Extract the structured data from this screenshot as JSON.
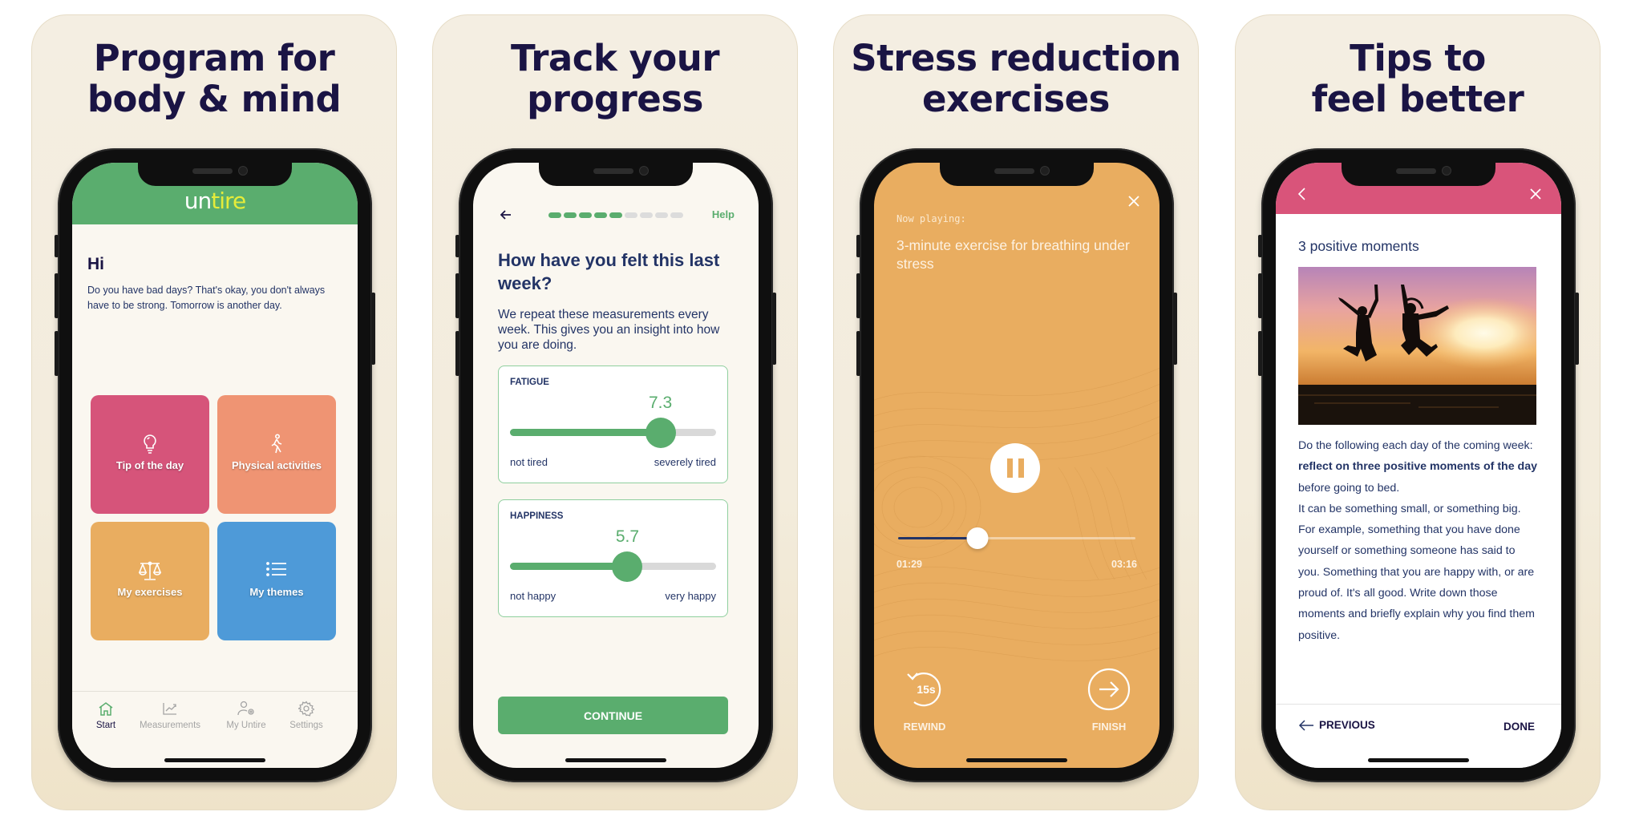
{
  "panels": [
    {
      "headline": [
        "Program for",
        "body & mind"
      ],
      "screen": {
        "logo": {
          "part1": "un",
          "part2": "tire"
        },
        "greeting": "Hi",
        "intro": "Do you have bad days? That's okay, you don't always have to be strong. Tomorrow is another day.",
        "tiles": [
          {
            "label": "Tip of the day",
            "icon": "lightbulb-icon",
            "color": "#d6547a"
          },
          {
            "label": "Physical activities",
            "icon": "walking-person-icon",
            "color": "#ef9473"
          },
          {
            "label": "My exercises",
            "icon": "balance-scale-icon",
            "color": "#e9ad60"
          },
          {
            "label": "My themes",
            "icon": "list-icon",
            "color": "#4e9ad8"
          }
        ],
        "tabbar": [
          {
            "label": "Start",
            "icon": "home-icon",
            "active": true
          },
          {
            "label": "Measurements",
            "icon": "chart-icon",
            "active": false
          },
          {
            "label": "My Untire",
            "icon": "user-settings-icon",
            "active": false
          },
          {
            "label": "Settings",
            "icon": "gear-icon",
            "active": false
          }
        ]
      }
    },
    {
      "headline": [
        "Track your",
        "progress"
      ],
      "screen": {
        "help_label": "Help",
        "progress": {
          "completed_steps": 5,
          "total_steps": 9
        },
        "title": "How have you felt this last week?",
        "subtitle": "We repeat these measurements every week. This gives you an insight into how you are doing.",
        "measurements": [
          {
            "label": "FATIGUE",
            "value": "7.3",
            "value_num": 7.3,
            "min": 0,
            "max": 10,
            "low_label": "not tired",
            "high_label": "severely tired"
          },
          {
            "label": "HAPPINESS",
            "value": "5.7",
            "value_num": 5.7,
            "min": 0,
            "max": 10,
            "low_label": "not happy",
            "high_label": "very happy"
          }
        ],
        "continue_label": "CONTINUE"
      }
    },
    {
      "headline": [
        "Stress reduction",
        "exercises"
      ],
      "screen": {
        "now_playing_label": "Now playing:",
        "track_title": "3-minute exercise for breathing under stress",
        "elapsed": "01:29",
        "duration": "03:16",
        "progress_fraction": 0.335,
        "rewind_label": "REWIND",
        "rewind_seconds": "15s",
        "finish_label": "FINISH"
      }
    },
    {
      "headline": [
        "Tips to",
        "feel better"
      ],
      "screen": {
        "title": "3 positive moments",
        "image_alt": "Two people jumping at sunset on a beach",
        "body_intro": "Do the following each day of the coming week: ",
        "body_bold": "reflect on three positive moments of the day",
        "body_after": " before going to bed.",
        "body_paragraph2": "It can be something small, or something big. For example, something that you have done yourself or something someone has said to you. Something that you are happy with, or are proud of. It's all good. Write down those moments and briefly explain why you find them positive.",
        "previous_label": "PREVIOUS",
        "done_label": "DONE"
      }
    }
  ],
  "colors": {
    "green": "#5aad6e",
    "navy": "#233466",
    "headline": "#1a1444",
    "pink": "#d9547a",
    "orange": "#e9ad60",
    "panel_bg": "#f3ecdc"
  }
}
